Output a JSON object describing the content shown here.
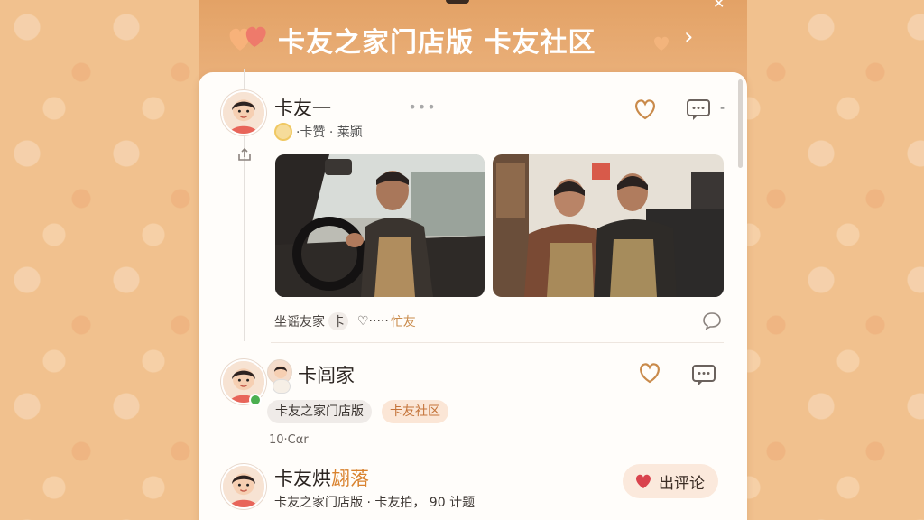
{
  "header": {
    "title": "卡友之家门店版 卡友社区"
  },
  "post": {
    "username": "卡友一",
    "badge_text": "·卡赞 · 莱颕",
    "caption_prefix": "坐谣友家",
    "caption_chip": "卡",
    "caption_mid": "♡·····",
    "caption_suffix": "忙友"
  },
  "comment": {
    "username": "卡闾家",
    "tags": [
      "卡友之家门店版",
      "卡友社区"
    ],
    "timestamp": "10·Cαr"
  },
  "footer_item": {
    "title_prefix": "卡友烘",
    "title_highlight": "翃落",
    "subtitle": "卡友之家门店版 · 卡友拍，  90 计题"
  },
  "reply_button": {
    "label": "出评论"
  },
  "colors": {
    "accent": "#c98a4a",
    "heart_red": "#d9434d",
    "card": "#fffdfa"
  }
}
